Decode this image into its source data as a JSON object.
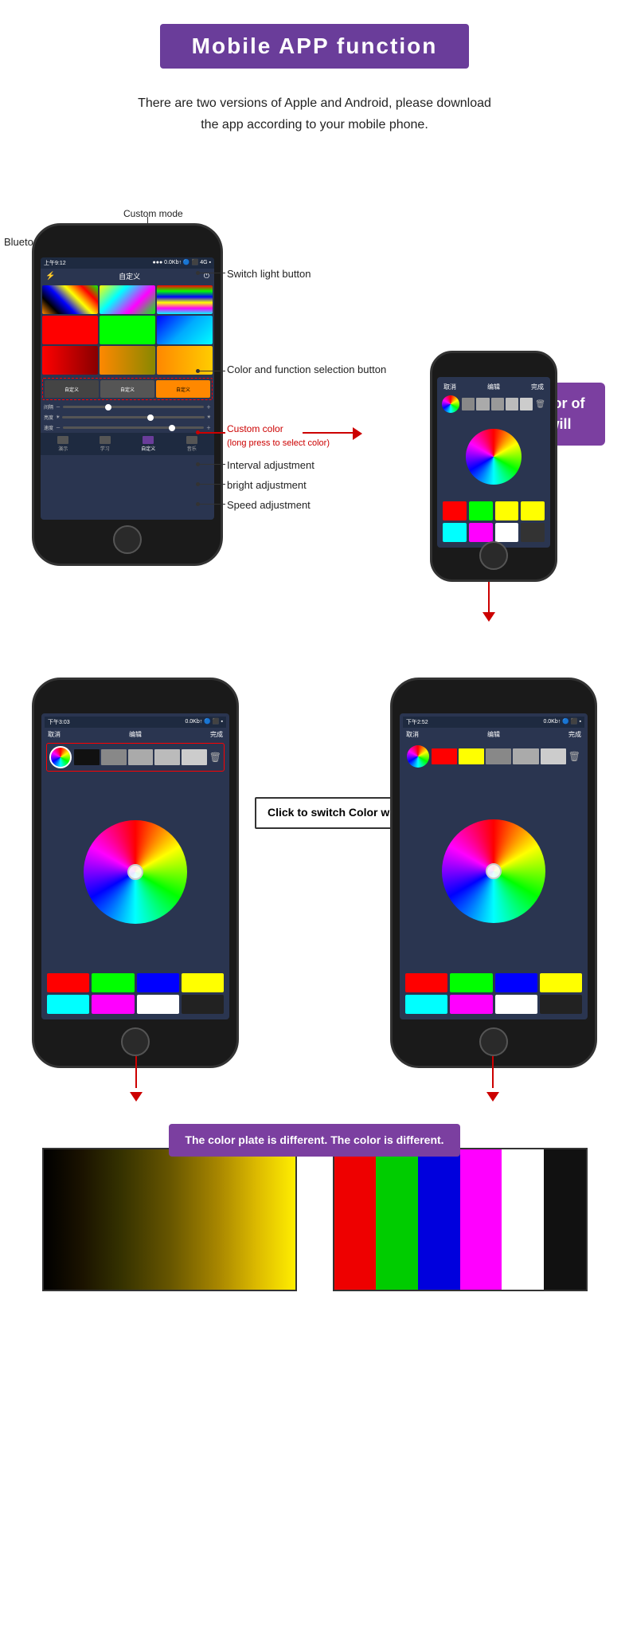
{
  "header": {
    "title": "Mobile  APP  function"
  },
  "subtitle": {
    "line1": "There are two versions of Apple and Android, please download",
    "line2": "the app according to your mobile phone."
  },
  "highlight": {
    "text": "Adjust the color of\nthe light at will"
  },
  "annotations": {
    "bluetooth": "Bluetooth status button",
    "custom_mode": "Custom mode",
    "switch_light": "Switch light\nbutton",
    "color_func": "Color and function\nselection button",
    "custom_color": "Custom color\n(long press to select color)",
    "interval": "Interval adjustment",
    "bright": "bright adjustment",
    "speed": "Speed adjustment"
  },
  "click_switch": {
    "text": "Click to switch\nColor wheel"
  },
  "plate_label": {
    "text": "The color plate is different.\nThe color is different."
  },
  "screen1": {
    "status": "上午9:12",
    "title": "自定义",
    "sliders": [
      "间隔",
      "亮度",
      "速度"
    ],
    "custom_cells": [
      "自定义",
      "自定义",
      "自定义"
    ]
  },
  "colors": {
    "accent": "#7b3fa0",
    "red_arrow": "#cc0000"
  }
}
